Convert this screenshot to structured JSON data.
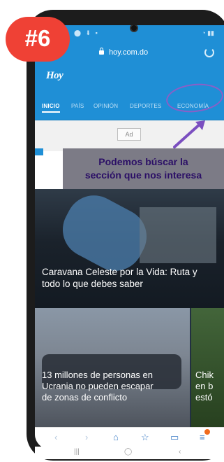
{
  "badge": {
    "label": "#6"
  },
  "browser": {
    "url": "hoy.com.do"
  },
  "site": {
    "logo": "Hoy"
  },
  "nav": {
    "items": [
      {
        "label": "INICIO"
      },
      {
        "label": "PAÍS"
      },
      {
        "label": "OPINIÓN"
      },
      {
        "label": "DEPORTES"
      },
      {
        "label": "ECONOMÍA"
      }
    ]
  },
  "ad": {
    "label": "Ad"
  },
  "callout": {
    "line1": "Podemos búscar la",
    "line2": "sección que nos interesa"
  },
  "articles": {
    "hero_title_line1": "Caravana Celeste por la Vida: Ruta y",
    "hero_title_line2": "todo lo que debes saber",
    "card1_line1": "13 millones de personas en",
    "card1_line2": "Ucrania no pueden escapar",
    "card1_line3": "de zonas de conflicto",
    "card2_line1": "Chik",
    "card2_line2": "en b",
    "card2_line3": "estó"
  },
  "colors": {
    "header_blue": "#1f8fd6",
    "badge_red": "#ef4135",
    "highlight_purple": "#8b5fc7"
  }
}
